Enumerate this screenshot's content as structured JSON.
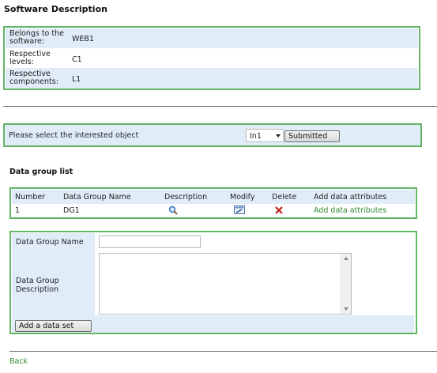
{
  "page_title": "Software Description",
  "software_info": {
    "rows": [
      {
        "label": "Belongs to the software:",
        "value": "WEB1"
      },
      {
        "label": "Respective levels:",
        "value": "C1"
      },
      {
        "label": "Respective components:",
        "value": "L1"
      }
    ]
  },
  "object_select": {
    "prompt": "Please select the interested object",
    "selected": "In1",
    "submit_label": "Submitted"
  },
  "data_group": {
    "title": "Data group list",
    "columns": [
      "Number",
      "Data Group Name",
      "Description",
      "Modify",
      "Delete",
      "Add data attributes"
    ],
    "rows": [
      {
        "number": "1",
        "name": "DG1",
        "add_link": "Add data attributes"
      }
    ]
  },
  "form": {
    "name_label": "Data Group Name",
    "name_value": "",
    "desc_label": "Data Group Description",
    "desc_value": "",
    "add_button": "Add a data set"
  },
  "back_label": "Back",
  "icons": {
    "description": "magnifier-icon",
    "modify": "edit-icon",
    "delete": "delete-x-icon"
  },
  "colors": {
    "border_green": "#66b466",
    "row_blue": "#e0ecf8",
    "link_green": "#2f8a2f",
    "delete_red": "#c0201c"
  }
}
